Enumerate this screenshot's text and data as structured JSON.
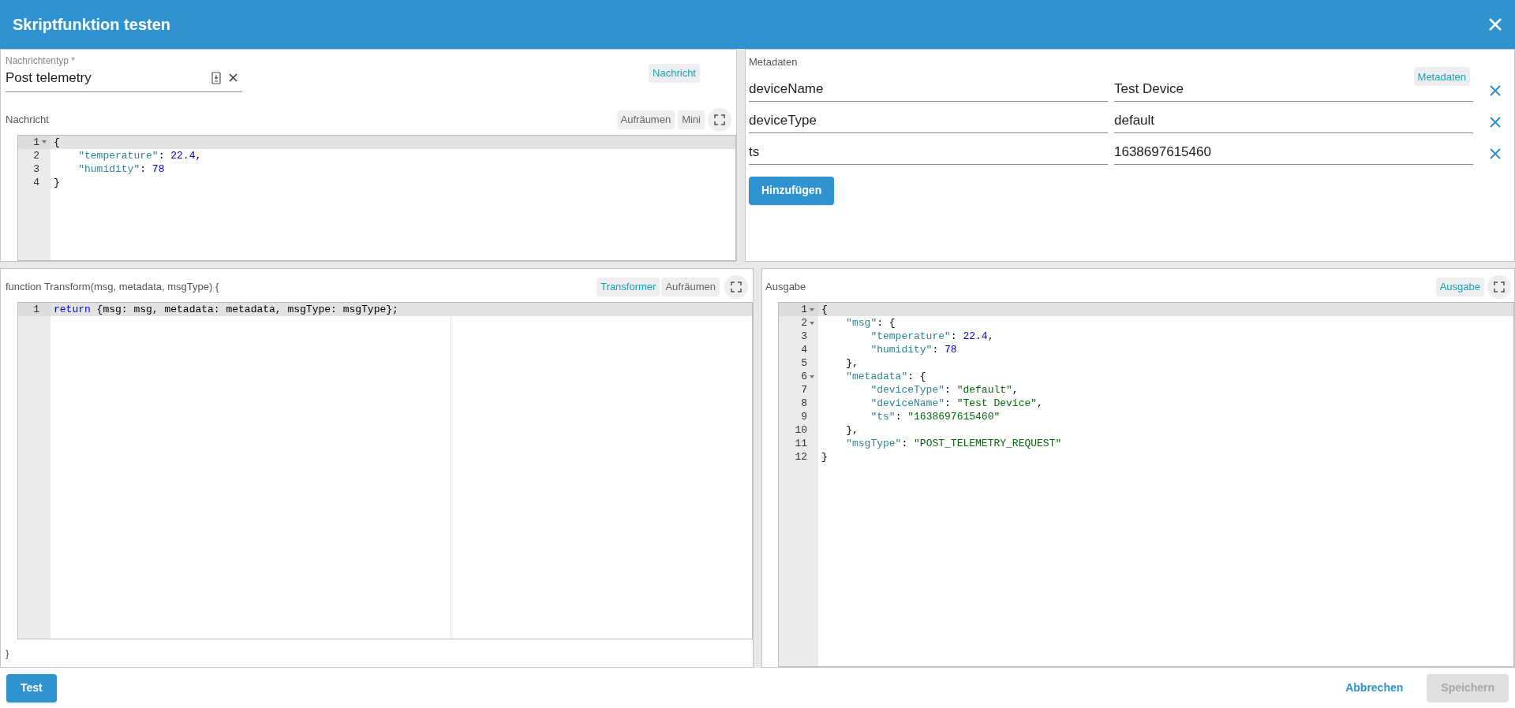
{
  "dialog": {
    "title": "Skriptfunktion testen"
  },
  "message_panel": {
    "type_field": {
      "label": "Nachrichtentyp *",
      "value": "Post telemetry"
    },
    "chip": "Nachricht",
    "editor_label": "Nachricht",
    "buttons": [
      "Aufräumen",
      "Mini"
    ],
    "editor": {
      "lines": [
        {
          "n": "1",
          "fold": true,
          "active": true,
          "tokens": [
            {
              "kind": "punct",
              "text": "{"
            }
          ]
        },
        {
          "n": "2",
          "fold": false,
          "active": false,
          "tokens": [
            {
              "kind": "key",
              "text": "    \"temperature\""
            },
            {
              "kind": "punct",
              "text": ": "
            },
            {
              "kind": "number",
              "text": "22.4"
            },
            {
              "kind": "punct",
              "text": ","
            }
          ]
        },
        {
          "n": "3",
          "fold": false,
          "active": false,
          "tokens": [
            {
              "kind": "key",
              "text": "    \"humidity\""
            },
            {
              "kind": "punct",
              "text": ": "
            },
            {
              "kind": "number",
              "text": "78"
            }
          ]
        },
        {
          "n": "4",
          "fold": false,
          "active": false,
          "tokens": [
            {
              "kind": "punct",
              "text": "}"
            }
          ]
        }
      ]
    }
  },
  "metadata_panel": {
    "label": "Metadaten",
    "chip": "Metadaten",
    "rows": [
      {
        "key": "deviceName",
        "value": "Test Device"
      },
      {
        "key": "deviceType",
        "value": "default"
      },
      {
        "key": "ts",
        "value": "1638697615460"
      }
    ],
    "add_button": "Hinzufügen"
  },
  "script_panel": {
    "header": "function Transform(msg, metadata, msgType) {",
    "chips": [
      "Transformer",
      "Aufräumen"
    ],
    "editor": {
      "lines": [
        {
          "n": "1",
          "fold": false,
          "active": true,
          "tokens": [
            {
              "kind": "keyword",
              "text": "return"
            },
            {
              "kind": "punct",
              "text": " {msg: msg, metadata: metadata, msgType: msgType};"
            }
          ]
        }
      ]
    },
    "footer": "}"
  },
  "output_panel": {
    "label": "Ausgabe",
    "chip": "Ausgabe",
    "editor": {
      "lines": [
        {
          "n": "1",
          "fold": true,
          "active": true,
          "tokens": [
            {
              "kind": "punct",
              "text": "{"
            }
          ]
        },
        {
          "n": "2",
          "fold": true,
          "active": false,
          "tokens": [
            {
              "kind": "key",
              "text": "    \"msg\""
            },
            {
              "kind": "punct",
              "text": ": {"
            }
          ]
        },
        {
          "n": "3",
          "fold": false,
          "active": false,
          "tokens": [
            {
              "kind": "key",
              "text": "        \"temperature\""
            },
            {
              "kind": "punct",
              "text": ": "
            },
            {
              "kind": "number",
              "text": "22.4"
            },
            {
              "kind": "punct",
              "text": ","
            }
          ]
        },
        {
          "n": "4",
          "fold": false,
          "active": false,
          "tokens": [
            {
              "kind": "key",
              "text": "        \"humidity\""
            },
            {
              "kind": "punct",
              "text": ": "
            },
            {
              "kind": "number",
              "text": "78"
            }
          ]
        },
        {
          "n": "5",
          "fold": false,
          "active": false,
          "tokens": [
            {
              "kind": "punct",
              "text": "    },"
            }
          ]
        },
        {
          "n": "6",
          "fold": true,
          "active": false,
          "tokens": [
            {
              "kind": "key",
              "text": "    \"metadata\""
            },
            {
              "kind": "punct",
              "text": ": {"
            }
          ]
        },
        {
          "n": "7",
          "fold": false,
          "active": false,
          "tokens": [
            {
              "kind": "key",
              "text": "        \"deviceType\""
            },
            {
              "kind": "punct",
              "text": ": "
            },
            {
              "kind": "string",
              "text": "\"default\""
            },
            {
              "kind": "punct",
              "text": ","
            }
          ]
        },
        {
          "n": "8",
          "fold": false,
          "active": false,
          "tokens": [
            {
              "kind": "key",
              "text": "        \"deviceName\""
            },
            {
              "kind": "punct",
              "text": ": "
            },
            {
              "kind": "string",
              "text": "\"Test Device\""
            },
            {
              "kind": "punct",
              "text": ","
            }
          ]
        },
        {
          "n": "9",
          "fold": false,
          "active": false,
          "tokens": [
            {
              "kind": "key",
              "text": "        \"ts\""
            },
            {
              "kind": "punct",
              "text": ": "
            },
            {
              "kind": "string",
              "text": "\"1638697615460\""
            }
          ]
        },
        {
          "n": "10",
          "fold": false,
          "active": false,
          "tokens": [
            {
              "kind": "punct",
              "text": "    },"
            }
          ]
        },
        {
          "n": "11",
          "fold": false,
          "active": false,
          "tokens": [
            {
              "kind": "key",
              "text": "    \"msgType\""
            },
            {
              "kind": "punct",
              "text": ": "
            },
            {
              "kind": "string",
              "text": "\"POST_TELEMETRY_REQUEST\""
            }
          ]
        },
        {
          "n": "12",
          "fold": false,
          "active": false,
          "tokens": [
            {
              "kind": "punct",
              "text": "}"
            }
          ]
        }
      ]
    }
  },
  "footer": {
    "test_button": "Test",
    "cancel_button": "Abbrechen",
    "save_button": {
      "label": "Speichern",
      "disabled": true
    }
  }
}
